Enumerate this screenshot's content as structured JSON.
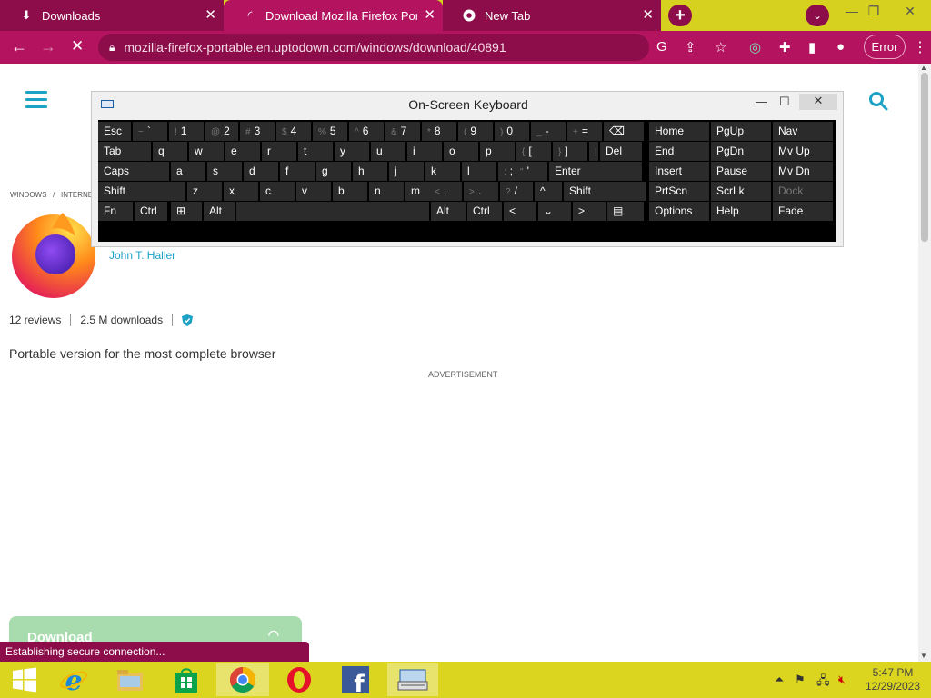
{
  "browser": {
    "tabs": [
      {
        "label": "Downloads",
        "icon": "download-icon"
      },
      {
        "label": "Download Mozilla Firefox Portable",
        "icon": "loading-spinner-icon"
      },
      {
        "label": "New Tab",
        "icon": "chrome-icon"
      }
    ],
    "new_tab_label": "+",
    "url": "mozilla-firefox-portable.en.uptodown.com/windows/download/40891",
    "error_label": "Error",
    "accent": "#b3135f",
    "tab_strip_color": "#d5d11e"
  },
  "page": {
    "breadcrumb": [
      "WINDOWS",
      "/",
      "INTERNE"
    ],
    "author": "John T. Haller",
    "reviews": "12 reviews",
    "downloads": "2.5 M downloads",
    "description": "Portable version for the most complete browser",
    "advertisement": "ADVERTISEMENT",
    "download_label": "Download"
  },
  "status": "Establishing secure connection...",
  "osk": {
    "title": "On-Screen Keyboard",
    "rows": [
      [
        {
          "l": "Esc"
        },
        {
          "s": "~",
          "l": "`"
        },
        {
          "s": "!",
          "l": "1"
        },
        {
          "s": "@",
          "l": "2"
        },
        {
          "s": "#",
          "l": "3"
        },
        {
          "s": "$",
          "l": "4"
        },
        {
          "s": "%",
          "l": "5"
        },
        {
          "s": "^",
          "l": "6"
        },
        {
          "s": "&",
          "l": "7"
        },
        {
          "s": "*",
          "l": "8"
        },
        {
          "s": "(",
          "l": "9"
        },
        {
          "s": ")",
          "l": "0"
        },
        {
          "s": "_",
          "l": "-"
        },
        {
          "s": "+",
          "l": "="
        },
        {
          "l": "⌫"
        },
        {
          "l": "Home"
        },
        {
          "l": "PgUp"
        },
        {
          "l": "Nav"
        }
      ],
      [
        {
          "l": "Tab"
        },
        {
          "l": "q"
        },
        {
          "l": "w"
        },
        {
          "l": "e"
        },
        {
          "l": "r"
        },
        {
          "l": "t"
        },
        {
          "l": "y"
        },
        {
          "l": "u"
        },
        {
          "l": "i"
        },
        {
          "l": "o"
        },
        {
          "l": "p"
        },
        {
          "s": "{",
          "l": "["
        },
        {
          "s": "}",
          "l": "]"
        },
        {
          "s": "|",
          "l": "\\"
        },
        {
          "l": "Del"
        },
        {
          "l": "End"
        },
        {
          "l": "PgDn"
        },
        {
          "l": "Mv Up"
        }
      ],
      [
        {
          "l": "Caps"
        },
        {
          "l": "a"
        },
        {
          "l": "s"
        },
        {
          "l": "d"
        },
        {
          "l": "f"
        },
        {
          "l": "g"
        },
        {
          "l": "h"
        },
        {
          "l": "j"
        },
        {
          "l": "k"
        },
        {
          "l": "l"
        },
        {
          "s": ":",
          "l": ";"
        },
        {
          "s": "\"",
          "l": "'"
        },
        {
          "l": "Enter"
        },
        {
          "l": "Insert"
        },
        {
          "l": "Pause"
        },
        {
          "l": "Mv Dn"
        }
      ],
      [
        {
          "l": "Shift"
        },
        {
          "l": "z"
        },
        {
          "l": "x"
        },
        {
          "l": "c"
        },
        {
          "l": "v"
        },
        {
          "l": "b"
        },
        {
          "l": "n"
        },
        {
          "l": "m"
        },
        {
          "s": "<",
          "l": ","
        },
        {
          "s": ">",
          "l": "."
        },
        {
          "s": "?",
          "l": "/"
        },
        {
          "l": "^"
        },
        {
          "l": "Shift"
        },
        {
          "l": "PrtScn"
        },
        {
          "l": "ScrLk"
        },
        {
          "l": "Dock"
        }
      ],
      [
        {
          "l": "Fn"
        },
        {
          "l": "Ctrl"
        },
        {
          "l": "⊞"
        },
        {
          "l": "Alt"
        },
        {
          "l": ""
        },
        {
          "l": "Alt"
        },
        {
          "l": "Ctrl"
        },
        {
          "l": "<"
        },
        {
          "l": "⌄"
        },
        {
          "l": ">"
        },
        {
          "l": "▤"
        },
        {
          "l": "Options"
        },
        {
          "l": "Help"
        },
        {
          "l": "Fade"
        }
      ]
    ]
  },
  "taskbar": {
    "apps": [
      "start-button",
      "ie-icon",
      "file-explorer-icon",
      "store-icon",
      "chrome-icon",
      "opera-icon",
      "facebook-icon",
      "osk-icon"
    ],
    "time": "5:47 PM",
    "date": "12/29/2023"
  }
}
